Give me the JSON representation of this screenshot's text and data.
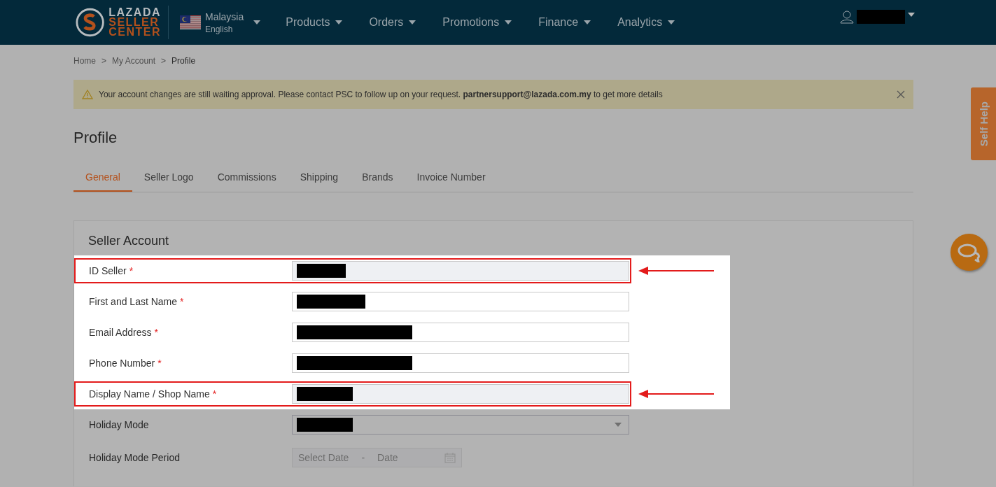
{
  "header": {
    "logo": {
      "line_1": "LAZADA",
      "line_2": "SELLER",
      "line_3": "CENTER"
    },
    "locale": {
      "country": "Malaysia",
      "language": "English"
    },
    "nav": [
      {
        "label": "Products"
      },
      {
        "label": "Orders"
      },
      {
        "label": "Promotions"
      },
      {
        "label": "Finance"
      },
      {
        "label": "Analytics"
      }
    ],
    "user": {
      "redacted": true
    }
  },
  "breadcrumb": [
    {
      "label": "Home",
      "current": false
    },
    {
      "label": "My Account",
      "current": false
    },
    {
      "label": "Profile",
      "current": true
    }
  ],
  "breadcrumb_separator": ">",
  "alert": {
    "text": "Your account changes are still waiting approval. Please contact PSC to follow up on your request. **partnersupport@lazada.com.my** to get more details"
  },
  "page_title": "Profile",
  "tabs": [
    {
      "label": "General",
      "selected": true
    },
    {
      "label": "Seller Logo",
      "selected": false
    },
    {
      "label": "Commissions",
      "selected": false
    },
    {
      "label": "Shipping",
      "selected": false
    },
    {
      "label": "Brands",
      "selected": false
    },
    {
      "label": "Invoice Number",
      "selected": false
    }
  ],
  "section_title": "Seller Account",
  "fields": [
    {
      "label": "ID Seller",
      "required_mark": "*",
      "kind": "text",
      "disabled": true,
      "redacted": true,
      "highlighted": true,
      "marked": true
    },
    {
      "label": "First and Last Name",
      "required_mark": "*",
      "kind": "text",
      "disabled": false,
      "redacted": true,
      "highlighted": true,
      "marked": false
    },
    {
      "label": "Email Address",
      "required_mark": "*",
      "kind": "text",
      "disabled": false,
      "redacted": true,
      "highlighted": true,
      "marked": false
    },
    {
      "label": "Phone Number",
      "required_mark": "*",
      "kind": "text",
      "disabled": false,
      "redacted": true,
      "highlighted": true,
      "marked": false
    },
    {
      "label": "Display Name / Shop Name",
      "required_mark": "*",
      "kind": "text",
      "disabled": true,
      "redacted": true,
      "highlighted": true,
      "marked": true
    },
    {
      "label": "Holiday Mode",
      "kind": "select",
      "disabled": false,
      "redacted": true,
      "highlighted": false,
      "marked": false
    },
    {
      "label": "Holiday Mode Period",
      "kind": "date_range",
      "disabled": true,
      "start_placeholder": "Select Date",
      "separator": "-",
      "end_placeholder": "Date",
      "highlighted": false,
      "marked": false
    }
  ],
  "self_help": {
    "label": "Self Help"
  }
}
